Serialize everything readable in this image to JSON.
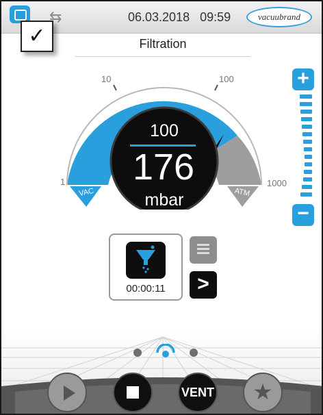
{
  "header": {
    "date": "06.03.2018",
    "time": "09:59",
    "logo_text": "vacuubrand",
    "home_icon": "home-icon",
    "usb_icon": "usb-icon"
  },
  "popup": {
    "check_symbol": "✓"
  },
  "page": {
    "title": "Filtration"
  },
  "gauge": {
    "scale_labels": {
      "min": "1",
      "tick1": "10",
      "tick2": "100",
      "max": "1000"
    },
    "vac_label": "VAC",
    "atm_label": "ATM",
    "setpoint_value": "100",
    "pressure_value": "176",
    "unit": "mbar",
    "colors": {
      "accent": "#2a9fde",
      "inactive": "#9e9e9e",
      "readout_bg": "#0d0d0d"
    }
  },
  "slider": {
    "plus_symbol": "+",
    "minus_symbol": "−"
  },
  "process": {
    "icon": "filter-funnel-icon",
    "timer": "00:00:11",
    "next_symbol": ">"
  },
  "pager": {
    "pages": 3,
    "active_index": 1
  },
  "controls": {
    "play_icon": "play-icon",
    "stop_icon": "stop-icon",
    "vent_label": "VENT",
    "favorite_symbol": "★"
  }
}
